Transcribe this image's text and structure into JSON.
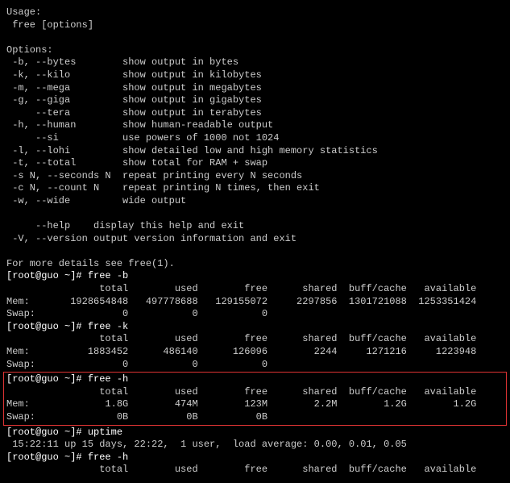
{
  "usage_header": "Usage:",
  "usage_line": " free [options]",
  "options_header": "Options:",
  "options": [
    {
      "flag": " -b, --bytes",
      "desc": "show output in bytes"
    },
    {
      "flag": " -k, --kilo",
      "desc": "show output in kilobytes"
    },
    {
      "flag": " -m, --mega",
      "desc": "show output in megabytes"
    },
    {
      "flag": " -g, --giga",
      "desc": "show output in gigabytes"
    },
    {
      "flag": "     --tera",
      "desc": "show output in terabytes"
    },
    {
      "flag": " -h, --human",
      "desc": "show human-readable output"
    },
    {
      "flag": "     --si",
      "desc": "use powers of 1000 not 1024"
    },
    {
      "flag": " -l, --lohi",
      "desc": "show detailed low and high memory statistics"
    },
    {
      "flag": " -t, --total",
      "desc": "show total for RAM + swap"
    },
    {
      "flag": " -s N, --seconds N",
      "desc": "repeat printing every N seconds"
    },
    {
      "flag": " -c N, --count N",
      "desc": "repeat printing N times, then exit"
    },
    {
      "flag": " -w, --wide",
      "desc": "wide output"
    }
  ],
  "help_options": [
    {
      "flag": "     --help",
      "desc": "display this help and exit"
    },
    {
      "flag": " -V, --version",
      "desc": "output version information and exit"
    }
  ],
  "footer": "For more details see free(1).",
  "prompt_b": {
    "prompt": "[root@guo ~]# ",
    "cmd": "free -b"
  },
  "table_b": {
    "headers": [
      "",
      "total",
      "used",
      "free",
      "shared",
      "buff/cache",
      "available"
    ],
    "rows": [
      {
        "label": "Mem:",
        "vals": [
          "1928654848",
          "497778688",
          "129155072",
          "2297856",
          "1301721088",
          "1253351424"
        ]
      },
      {
        "label": "Swap:",
        "vals": [
          "0",
          "0",
          "0",
          "",
          "",
          ""
        ]
      }
    ]
  },
  "prompt_k": {
    "prompt": "[root@guo ~]# ",
    "cmd": "free -k"
  },
  "table_k": {
    "headers": [
      "",
      "total",
      "used",
      "free",
      "shared",
      "buff/cache",
      "available"
    ],
    "rows": [
      {
        "label": "Mem:",
        "vals": [
          "1883452",
          "486140",
          "126096",
          "2244",
          "1271216",
          "1223948"
        ]
      },
      {
        "label": "Swap:",
        "vals": [
          "0",
          "0",
          "0",
          "",
          "",
          ""
        ]
      }
    ]
  },
  "prompt_h": {
    "prompt": "[root@guo ~]# ",
    "cmd": "free -h"
  },
  "table_h": {
    "headers": [
      "",
      "total",
      "used",
      "free",
      "shared",
      "buff/cache",
      "available"
    ],
    "rows": [
      {
        "label": "Mem:",
        "vals": [
          "1.8G",
          "474M",
          "123M",
          "2.2M",
          "1.2G",
          "1.2G"
        ]
      },
      {
        "label": "Swap:",
        "vals": [
          "0B",
          "0B",
          "0B",
          "",
          "",
          ""
        ]
      }
    ]
  },
  "prompt_uptime": {
    "prompt": "[root@guo ~]# ",
    "cmd": "uptime"
  },
  "uptime_out": " 15:22:11 up 15 days, 22:22,  1 user,  load average: 0.00, 0.01, 0.05",
  "prompt_h2": {
    "prompt": "[root@guo ~]# ",
    "cmd": "free -h"
  },
  "table_h2": {
    "headers": [
      "",
      "total",
      "used",
      "free",
      "shared",
      "buff/cache",
      "available"
    ]
  }
}
